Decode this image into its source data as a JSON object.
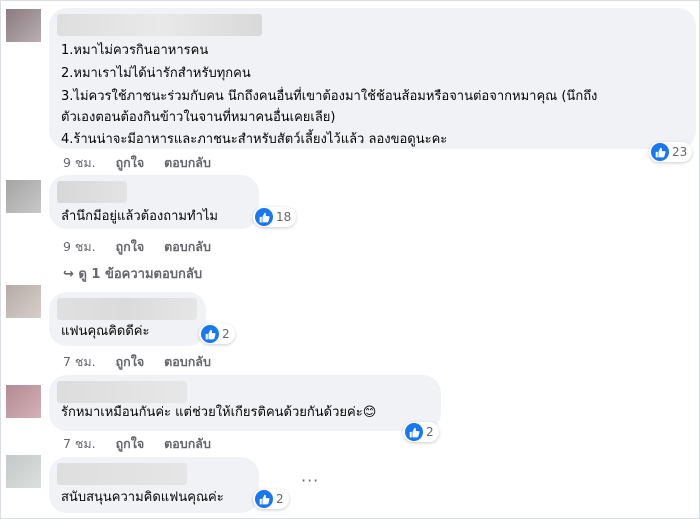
{
  "colors": {
    "bubble": "#f0f2f5",
    "like": "#1877f2",
    "meta": "#65676b"
  },
  "labels": {
    "like": "ถูกใจ",
    "reply": "ตอบกลับ"
  },
  "comments": [
    {
      "lines": [
        "1.หมาไม่ควรกินอาหารคน",
        "2.หมาเราไม่ได้น่ารักสำหรับทุกคน",
        "3.ไม่ควรใช้ภาชนะร่วมกับคน นึกถึงคนอื่นที่เขาต้องมาใช้ช้อนส้อมหรือจานต่อจากหมาคุณ (นึกถึง",
        "ตัวเองตอนต้องกินข้าวในจานที่หมาคนอื่นเคยเลีย)",
        "4.ร้านน่าจะมีอาหารและภาชนะสำหรับสัตว์เลี้ยงไว้แล้ว ลองขอดูนะคะ"
      ],
      "time": "9 ชม.",
      "reactions": "23"
    },
    {
      "lines": [
        "ลำนึกมีอยู่แล้วต้องถามทำไม"
      ],
      "time": "9 ชม.",
      "reactions": "18",
      "replies": "ดู 1 ข้อความตอบกลับ"
    },
    {
      "lines": [
        "แฟนคุณคิดดีค่ะ"
      ],
      "time": "7 ชม.",
      "reactions": "2"
    },
    {
      "lines": [
        "รักหมาเหมือนกันค่ะ แต่ช่วยให้เกียรติคนด้วยกันด้วยค่ะ😊"
      ],
      "time": "7 ชม.",
      "reactions": "2"
    },
    {
      "lines": [
        "สนับสนุนความคิดแฟนคุณค่ะ"
      ],
      "reactions": "2"
    }
  ]
}
